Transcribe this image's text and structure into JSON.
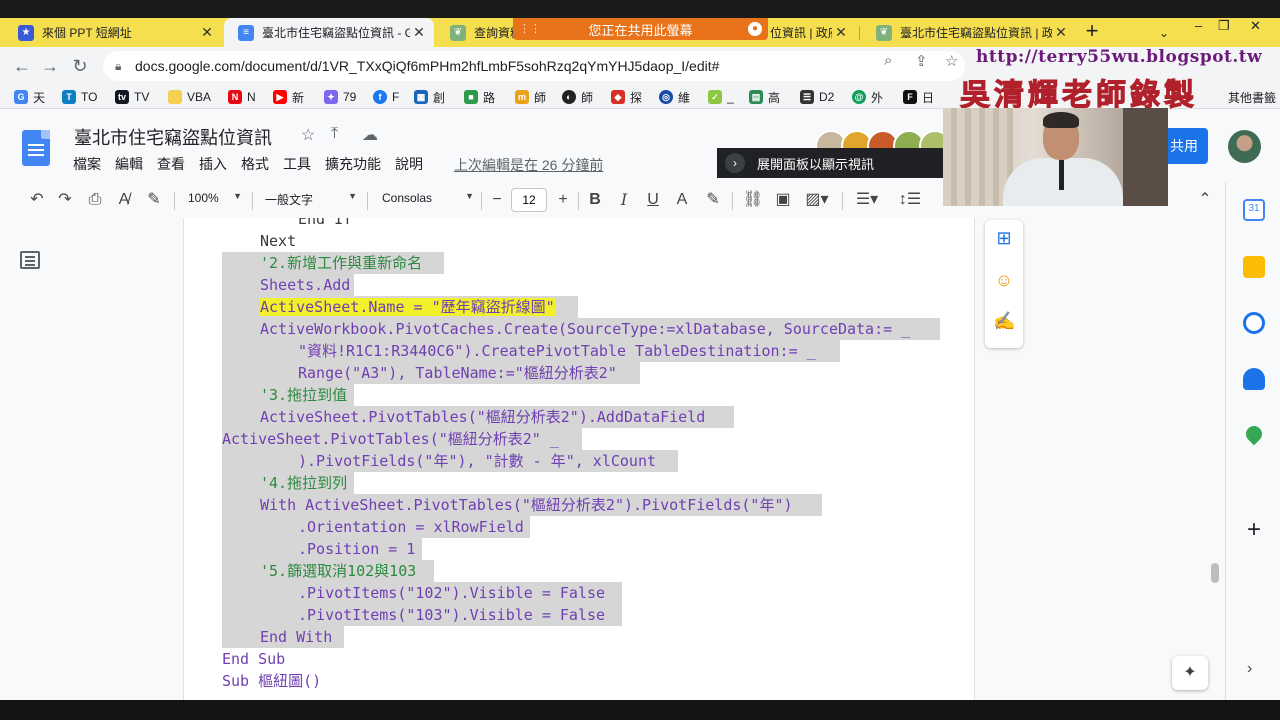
{
  "browser": {
    "tabs": [
      {
        "title": "來個 PPT 短網址",
        "active": false
      },
      {
        "title": "臺北市住宅竊盜點位資訊 - Go",
        "active": true
      },
      {
        "title": "查詢資料",
        "active": false
      },
      {
        "title": "位資訊 | 政府",
        "active": false
      },
      {
        "title": "臺北市住宅竊盜點位資訊 | 政府",
        "active": false
      }
    ],
    "share_notice": "您正在共用此螢幕",
    "url": "docs.google.com/document/d/1VR_TXxQiQf6mPHm2hfLmbF5sohRzq2qYmYHJ5daop_I/edit#",
    "bookmarks": [
      "天",
      "TO",
      "TV",
      "VBA",
      "N",
      "新",
      "79",
      "F",
      "創",
      "路",
      "師",
      "師",
      "探",
      "維",
      "_",
      "高",
      "D2",
      "外",
      "日"
    ],
    "other_bookmarks": "其他書籤"
  },
  "doc": {
    "title": "臺北市住宅竊盜點位資訊",
    "menu": [
      "檔案",
      "編輯",
      "查看",
      "插入",
      "格式",
      "工具",
      "擴充功能",
      "說明"
    ],
    "last_edit": "上次編輯是在 26 分鐘前",
    "share_label": "共用",
    "panel_tooltip": "展開面板以顯示視訊"
  },
  "toolbar": {
    "zoom": "100%",
    "style": "一般文字",
    "font": "Consolas",
    "font_size": "12",
    "size_minus": "−",
    "size_plus": "+"
  },
  "code_lines": [
    {
      "indent": 8,
      "text": "End If",
      "selected": false
    },
    {
      "indent": 4,
      "text": "Next",
      "selected": false
    },
    {
      "indent": 4,
      "text": "'2.新增工作與重新命名",
      "selected": true
    },
    {
      "indent": 4,
      "text": "Sheets.Add",
      "selected": true
    },
    {
      "indent": 4,
      "text": "ActiveSheet.Name = \"歷年竊盜折線圖\"",
      "selected": true,
      "highlight": true
    },
    {
      "indent": 4,
      "text": "ActiveWorkbook.PivotCaches.Create(SourceType:=xlDatabase, SourceData:= _",
      "selected": true
    },
    {
      "indent": 8,
      "text": "\"資料!R1C1:R3440C6\").CreatePivotTable TableDestination:= _",
      "selected": true
    },
    {
      "indent": 8,
      "text": "Range(\"A3\"), TableName:=\"樞紐分析表2\"",
      "selected": true,
      "highlight_prefix": "Range(\"A3\")"
    },
    {
      "indent": 4,
      "text": "'3.拖拉到值",
      "selected": true
    },
    {
      "indent": 4,
      "text": "ActiveSheet.PivotTables(\"樞紐分析表2\").AddDataField",
      "selected": true
    },
    {
      "indent": 0,
      "text": "ActiveSheet.PivotTables(\"樞紐分析表2\" _",
      "selected": true
    },
    {
      "indent": 8,
      "text": ").PivotFields(\"年\"), \"計數 - 年\", xlCount",
      "selected": true
    },
    {
      "indent": 4,
      "text": "'4.拖拉到列",
      "selected": true
    },
    {
      "indent": 4,
      "text": "With ActiveSheet.PivotTables(\"樞紐分析表2\").PivotFields(\"年\")",
      "selected": true
    },
    {
      "indent": 8,
      "text": ".Orientation = xlRowField",
      "selected": true
    },
    {
      "indent": 8,
      "text": ".Position = 1",
      "selected": true
    },
    {
      "indent": 4,
      "text": "'5.篩選取消102與103",
      "selected": true
    },
    {
      "indent": 8,
      "text": ".PivotItems(\"102\").Visible = False",
      "selected": true
    },
    {
      "indent": 8,
      "text": ".PivotItems(\"103\").Visible = False",
      "selected": true
    },
    {
      "indent": 4,
      "text": "End With",
      "selected": true
    },
    {
      "indent": 0,
      "text": "End Sub",
      "selected": false
    },
    {
      "indent": 0,
      "text": "Sub 樞紐圖()",
      "selected": false
    }
  ],
  "overlay": {
    "blog_url": "http://terry55wu.blogspot.tw",
    "signature": "吳清輝老師錄製"
  },
  "colors": {
    "tabstrip": "#f6df4f",
    "share_bar": "#e8731a",
    "selection": "#d6d6d6",
    "highlight": "#f1f02a",
    "comment": "#2b8a3e",
    "docs_blue": "#1a73e8"
  }
}
